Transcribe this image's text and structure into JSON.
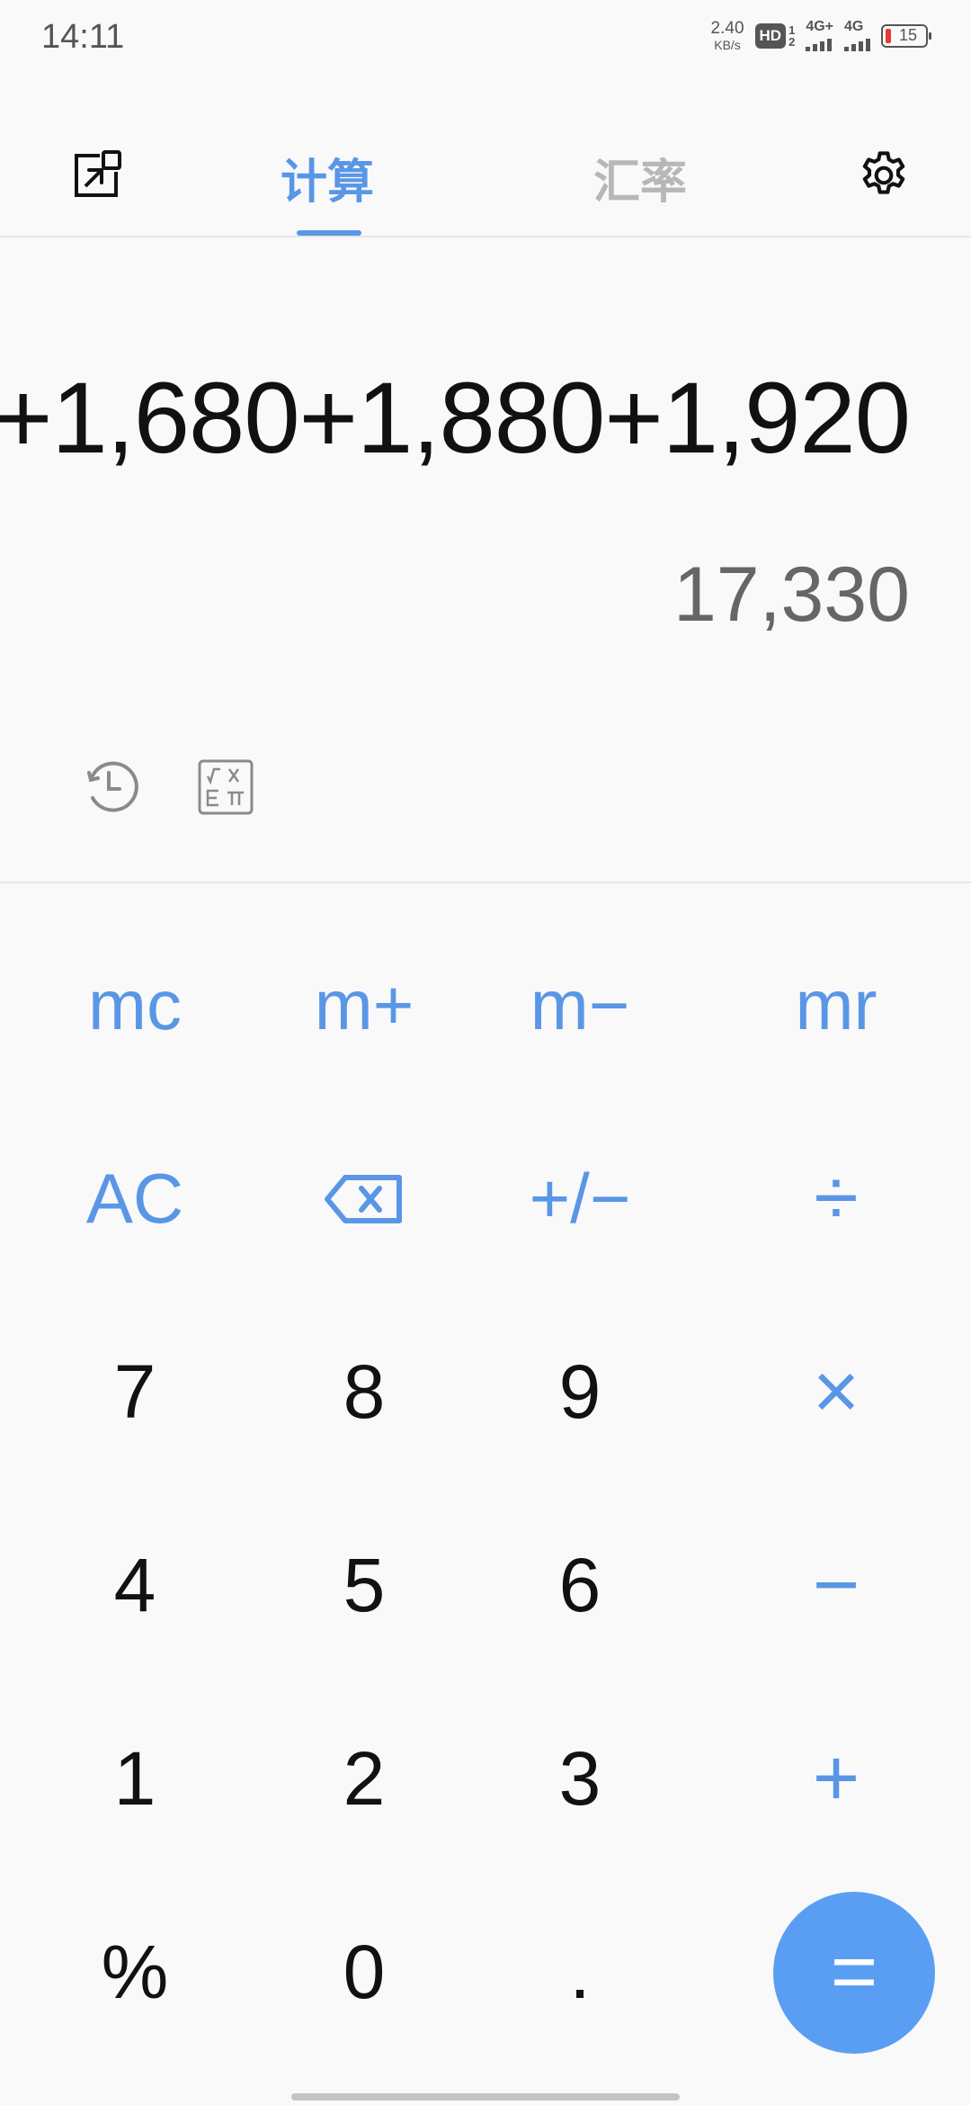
{
  "status_bar": {
    "time": "14:11",
    "net_speed_value": "2.40",
    "net_speed_unit": "KB/s",
    "hd_label": "HD",
    "sim1": "1",
    "sim2": "2",
    "net1": "4G+",
    "net2": "4G",
    "battery": "15"
  },
  "header": {
    "tabs": [
      {
        "label": "计算",
        "active": true
      },
      {
        "label": "汇率",
        "active": false
      }
    ]
  },
  "display": {
    "expression": "+1,680+1,880+1,920",
    "result": "17,330"
  },
  "keypad": {
    "rows": [
      [
        "mc",
        "m+",
        "m−",
        "mr"
      ],
      [
        "AC",
        "⌫",
        "+/−",
        "÷"
      ],
      [
        "7",
        "8",
        "9",
        "×"
      ],
      [
        "4",
        "5",
        "6",
        "−"
      ],
      [
        "1",
        "2",
        "3",
        "+"
      ],
      [
        "%",
        "0",
        ".",
        "="
      ]
    ]
  },
  "colors": {
    "accent": "#5a96e6",
    "equals_bg": "#5a9ef4",
    "background": "#f9f9fa",
    "battery_low": "#e53935"
  }
}
